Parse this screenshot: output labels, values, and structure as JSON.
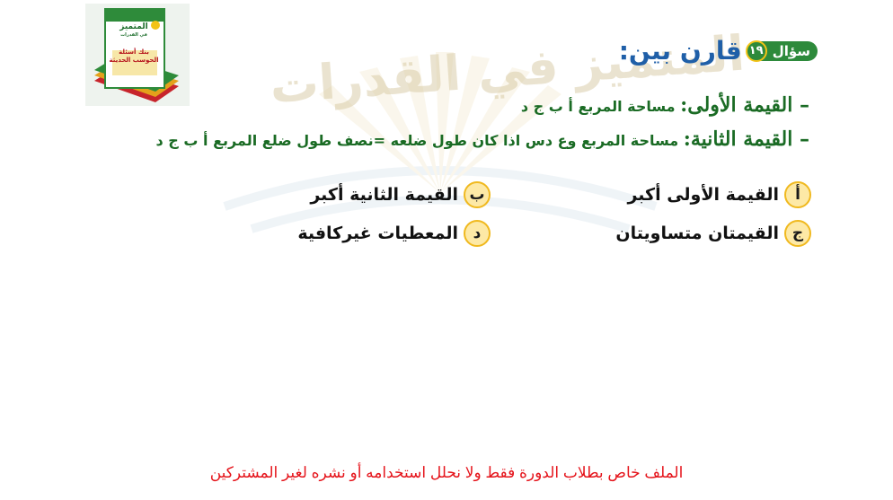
{
  "book": {
    "title": "المتميز",
    "subtitle": "في القدرات",
    "line1": "بنك أسئلة",
    "line2": "الحوسب الحديثة"
  },
  "watermark": {
    "text": "المتميز في القدرات"
  },
  "question": {
    "label": "سؤال",
    "number": "١٩",
    "title": "قارن بين:"
  },
  "values": {
    "first_label": "– القيمة الأولى:",
    "first_text": "  مساحة المربع أ ب ج د",
    "second_label": "– القيمة الثانية:",
    "second_text": " مساحة المربع وع دس اذا كان طول ضلعه =نصف طول ضلع المربع أ ب ج د"
  },
  "options": [
    {
      "letter": "أ",
      "text": "القيمة الأولى أكبر"
    },
    {
      "letter": "ب",
      "text": "القيمة الثانية أكبر"
    },
    {
      "letter": "ج",
      "text": "القيمتان متساويتان"
    },
    {
      "letter": "د",
      "text": "المعطيات غيركافية"
    }
  ],
  "footer": {
    "notice": "الملف خاص بطلاب الدورة فقط ولا نحلل استخدامه أو نشره لغير المشتركين"
  },
  "colors": {
    "badge_green": "#2d8a3b",
    "title_blue": "#1f5fa8",
    "value_green": "#1a6b24",
    "option_circle": "#fde9a6",
    "option_border": "#f0b91f",
    "notice_red": "#e5141b"
  }
}
